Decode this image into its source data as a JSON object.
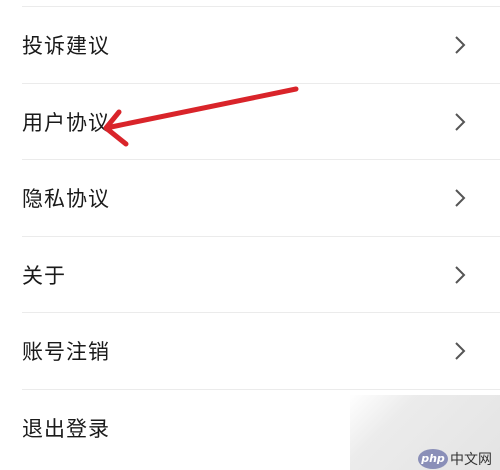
{
  "menu": {
    "items": [
      {
        "label": "投诉建议"
      },
      {
        "label": "用户协议"
      },
      {
        "label": "隐私协议"
      },
      {
        "label": "关于"
      },
      {
        "label": "账号注销"
      },
      {
        "label": "退出登录"
      }
    ]
  },
  "annotation": {
    "arrow_color": "#d9242a"
  },
  "watermark": {
    "logo_text": "php",
    "site_text": "中文网"
  },
  "icons": {
    "row_chevron": "chevron-right-icon"
  }
}
